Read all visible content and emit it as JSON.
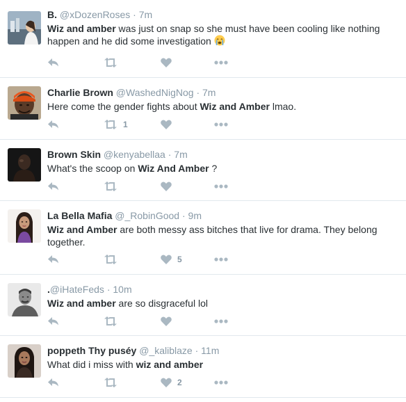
{
  "tweets": [
    {
      "fullname": "B.",
      "username": "@xDozenRoses",
      "separator": "·",
      "time": "7m",
      "text_parts": [
        {
          "t": "Wiz and amber",
          "b": true
        },
        {
          "t": " was just on snap so she must have been cooling like nothing happen and he did some investigation ",
          "b": false
        }
      ],
      "emoji": "crying-face-emoji",
      "retweet_count": "",
      "like_count": ""
    },
    {
      "fullname": "Charlie Brown",
      "username": "@WashedNigNog",
      "separator": "·",
      "time": "7m",
      "text_parts": [
        {
          "t": "Here come the gender fights about ",
          "b": false
        },
        {
          "t": "Wiz and Amber",
          "b": true
        },
        {
          "t": " lmao.",
          "b": false
        }
      ],
      "retweet_count": "1",
      "like_count": ""
    },
    {
      "fullname": "Brown Skin",
      "username": "@kenyabellaa",
      "separator": "·",
      "time": "7m",
      "text_parts": [
        {
          "t": "What's the scoop on ",
          "b": false
        },
        {
          "t": "Wiz And Amber",
          "b": true
        },
        {
          "t": " ?",
          "b": false
        }
      ],
      "retweet_count": "",
      "like_count": ""
    },
    {
      "fullname": "La Bella Mafia",
      "username": "@_RobinGood",
      "separator": "·",
      "time": "9m",
      "text_parts": [
        {
          "t": "Wiz and Amber",
          "b": true
        },
        {
          "t": " are both messy ass bitches that live for drama. They belong together.",
          "b": false
        }
      ],
      "retweet_count": "",
      "like_count": "5"
    },
    {
      "fullname": ".",
      "username": "@iHateFeds",
      "separator": "·",
      "time": "10m",
      "text_parts": [
        {
          "t": "Wiz and amber",
          "b": true
        },
        {
          "t": " are so disgraceful lol",
          "b": false
        }
      ],
      "retweet_count": "",
      "like_count": ""
    },
    {
      "fullname": "poppeth Thy puséy",
      "username": "@_kaliblaze",
      "separator": "·",
      "time": "11m",
      "text_parts": [
        {
          "t": "What did i miss with ",
          "b": false
        },
        {
          "t": "wiz and amber",
          "b": true
        }
      ],
      "retweet_count": "",
      "like_count": "2"
    }
  ],
  "icons": {
    "reply": "reply-icon",
    "retweet": "retweet-icon",
    "like": "heart-icon",
    "more": "more-dots-icon"
  },
  "colors": {
    "icon": "#aab8c2",
    "meta": "#8899a6",
    "text": "#292f33",
    "divider": "#e1e8ed"
  }
}
